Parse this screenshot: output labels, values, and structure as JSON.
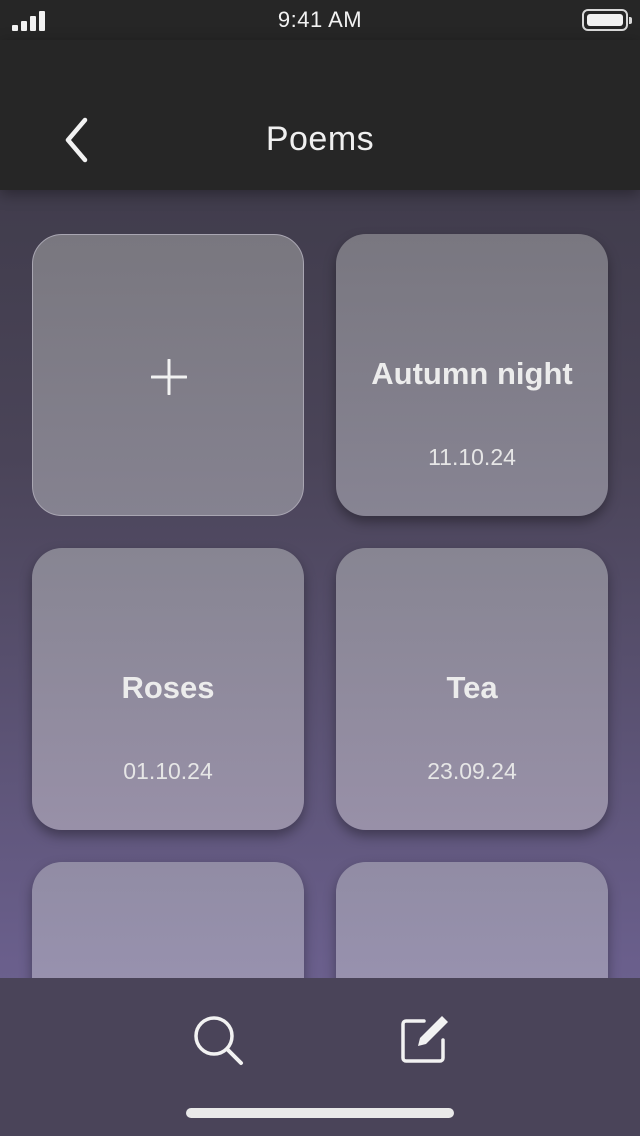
{
  "status_bar": {
    "time": "9:41 AM"
  },
  "header": {
    "title": "Poems",
    "back_icon": "chevron-left-icon"
  },
  "add_card": {
    "icon": "plus-icon"
  },
  "poems": [
    {
      "title": "Autumn night",
      "date": "11.10.24"
    },
    {
      "title": "Roses",
      "date": "01.10.24"
    },
    {
      "title": "Tea",
      "date": "23.09.24"
    }
  ],
  "tab_bar": {
    "search_icon": "search-icon",
    "compose_icon": "compose-icon"
  },
  "colors": {
    "header_bg": "#262626",
    "tab_bar_bg": "#4a4459",
    "card_text": "#ececec"
  }
}
